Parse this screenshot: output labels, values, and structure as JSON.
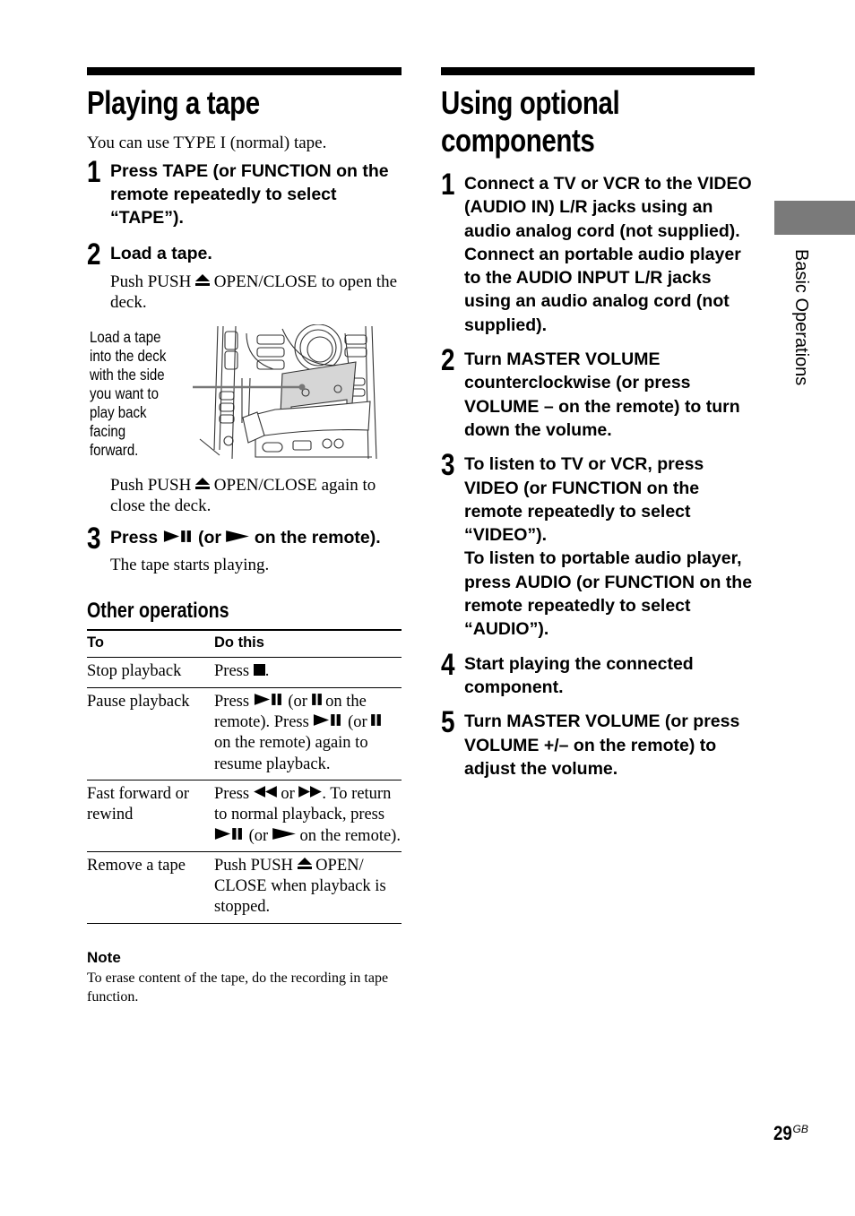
{
  "page": {
    "number": "29",
    "number_suffix": "GB",
    "side_tab_label": "Basic Operations",
    "side_tab_color": "#7a7a7a"
  },
  "left": {
    "title": "Playing a tape",
    "intro": "You can use TYPE I (normal) tape.",
    "steps": [
      {
        "num": "1",
        "title": "Press TAPE (or FUNCTION on the remote repeatedly to select “TAPE”)."
      },
      {
        "num": "2",
        "title": "Load a tape.",
        "body_before_icon": "Push PUSH ",
        "body_icon": "eject-icon",
        "body_after_icon": " OPEN/CLOSE to open the deck.",
        "figure_caption": "Load a tape into the deck with the side you want to play back facing forward.",
        "body2_before_icon": "Push PUSH ",
        "body2_after_icon": " OPEN/CLOSE again to close the deck."
      },
      {
        "num": "3",
        "title_part1": "Press ",
        "title_icon1": "play-pause-icon",
        "title_part2": " (or ",
        "title_icon2": "play-icon",
        "title_part3": " on the remote).",
        "body": "The tape starts playing."
      }
    ],
    "other_operations": {
      "heading": "Other operations",
      "columns": [
        "To",
        "Do this"
      ],
      "rows": [
        {
          "to": "Stop playback",
          "do": {
            "t1": "Press ",
            "i1": "stop-icon",
            "t2": "."
          }
        },
        {
          "to": "Pause playback",
          "do": {
            "t1": "Press ",
            "i1": "play-pause-icon",
            "t2": " (or ",
            "i2": "pause-icon",
            "t3": " on the remote). Press ",
            "i3": "play-pause-icon",
            "t4": " (or ",
            "i4": "pause-icon",
            "t5": " on the remote) again to resume playback."
          }
        },
        {
          "to": "Fast forward or rewind",
          "do": {
            "t1": "Press ",
            "i1": "rewind-icon",
            "t2": " or ",
            "i2": "fast-forward-icon",
            "t3": ". To return to normal playback, press ",
            "i3": "play-pause-icon",
            "t4": " (or ",
            "i4": "play-icon",
            "t5": " on the remote)."
          }
        },
        {
          "to": "Remove a tape",
          "do": {
            "t1": "Push PUSH ",
            "i1": "eject-icon",
            "t2": " OPEN/ CLOSE when playback is stopped."
          }
        }
      ]
    },
    "note": {
      "heading": "Note",
      "body": "To erase content of the tape, do the recording in tape function."
    }
  },
  "right": {
    "title_line1": "Using optional",
    "title_line2": "components",
    "steps": [
      {
        "num": "1",
        "title": "Connect a TV or VCR to the VIDEO (AUDIO IN) L/R jacks using an audio analog cord (not supplied).",
        "title2": "Connect an portable audio player to the AUDIO INPUT L/R jacks using an audio analog cord (not supplied)."
      },
      {
        "num": "2",
        "title": "Turn MASTER VOLUME counterclockwise (or press VOLUME – on the remote) to turn down the volume."
      },
      {
        "num": "3",
        "title": "To listen to TV or VCR, press VIDEO (or FUNCTION on the remote repeatedly to select “VIDEO”).",
        "title2": "To listen to portable audio player, press AUDIO (or FUNCTION on the remote repeatedly to select “AUDIO”)."
      },
      {
        "num": "4",
        "title": "Start playing the connected component."
      },
      {
        "num": "5",
        "title": "Turn MASTER VOLUME (or press VOLUME +/– on the remote) to adjust the volume."
      }
    ]
  }
}
